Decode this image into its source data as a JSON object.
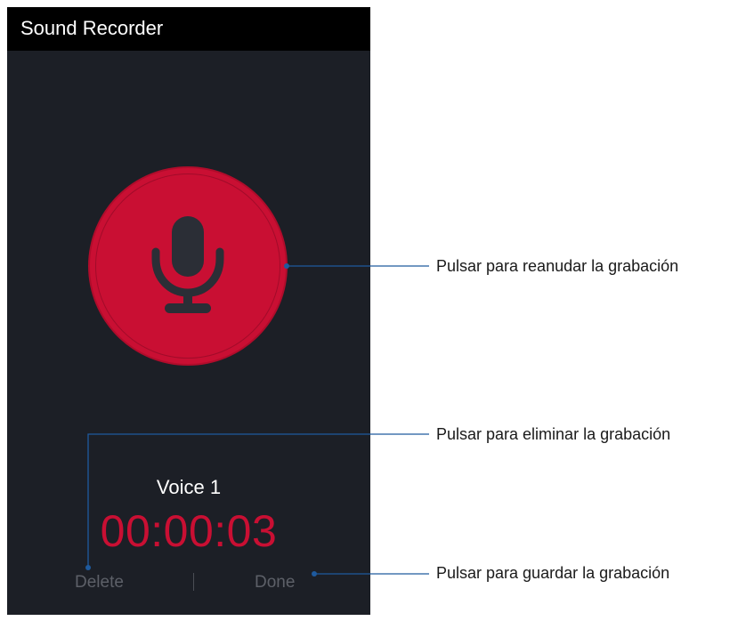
{
  "app_bar": {
    "title": "Sound Recorder"
  },
  "recorder": {
    "record_button_icon": "microphone-icon",
    "recording_name": "Voice 1",
    "elapsed_time": "00:00:03",
    "delete_label": "Delete",
    "done_label": "Done"
  },
  "callouts": {
    "resume": "Pulsar para reanudar la grabación",
    "delete": "Pulsar para eliminar la grabación",
    "save": "Pulsar para guardar la grabación"
  },
  "colors": {
    "screen_background": "#1c1f26",
    "app_bar_background": "#000000",
    "accent_red": "#c90f33",
    "callout_line": "#1e5a9e"
  }
}
